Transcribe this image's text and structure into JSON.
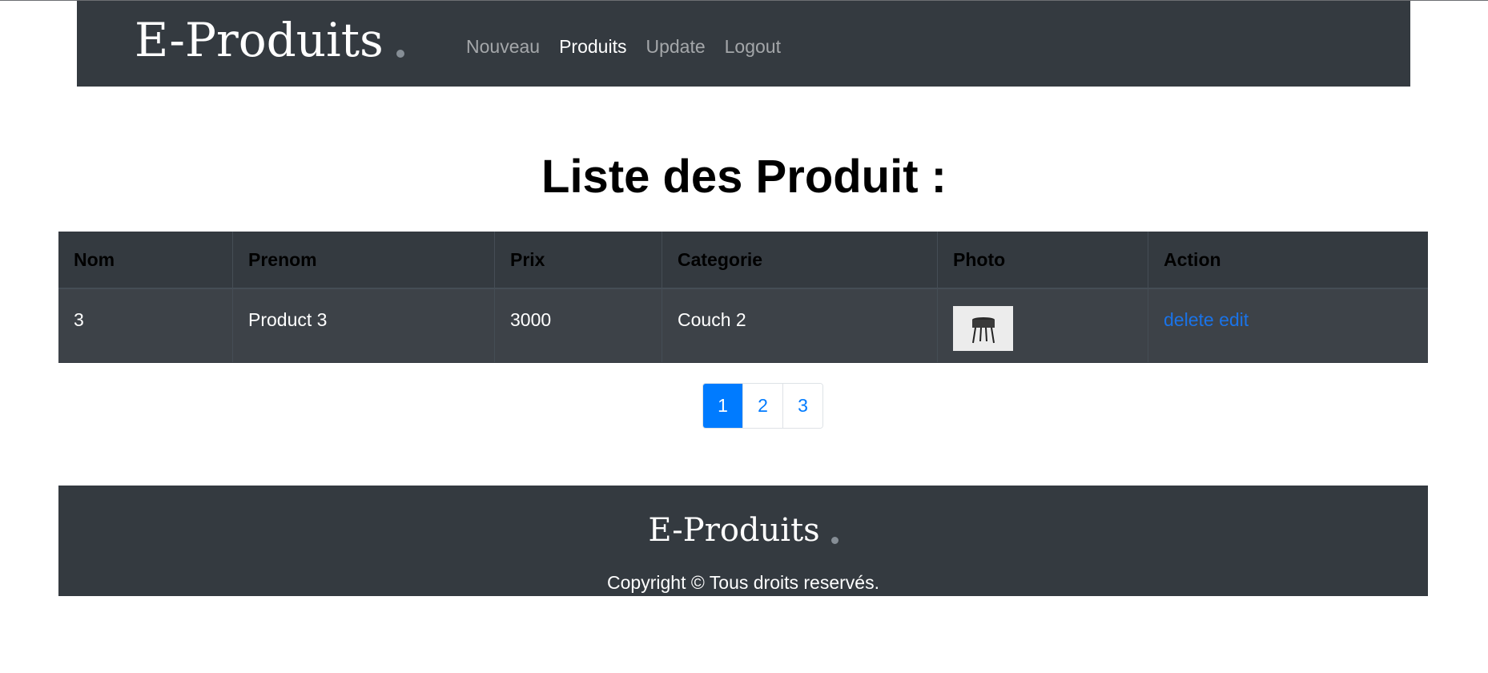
{
  "header": {
    "brand": "E-Produits",
    "nav": [
      {
        "label": "Nouveau",
        "active": false
      },
      {
        "label": "Produits",
        "active": true
      },
      {
        "label": "Update",
        "active": false
      },
      {
        "label": "Logout",
        "active": false
      }
    ]
  },
  "main": {
    "title": "Liste des Produit :",
    "table": {
      "columns": [
        "Nom",
        "Prenom",
        "Prix",
        "Categorie",
        "Photo",
        "Action"
      ],
      "rows": [
        {
          "nom": "3",
          "prenom": "Product 3",
          "prix": "3000",
          "categorie": "Couch 2",
          "photo": "side-table-image",
          "actions": {
            "delete": "delete",
            "edit": "edit"
          }
        }
      ]
    },
    "pagination": {
      "pages": [
        "1",
        "2",
        "3"
      ],
      "current": "1"
    }
  },
  "footer": {
    "brand": "E-Produits",
    "copyright": "Copyright © Tous droits reservés."
  },
  "colors": {
    "dark": "#343a40",
    "link": "#1a73e8",
    "primary": "#007bff"
  }
}
